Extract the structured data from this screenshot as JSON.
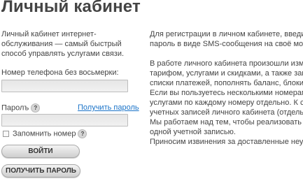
{
  "page": {
    "title": "Личный кабинет"
  },
  "intro": {
    "text": "Личный кабинет интернет-обслуживания — самый быстрый способ управлять услугами связи."
  },
  "form": {
    "phone_label": "Номер телефона без восьмерки:",
    "phone_value": "",
    "password_label": "Паролъ",
    "password_value": "",
    "password_help_icon": "question-icon",
    "get_password_link": "Получить пароль",
    "remember_label": "Запомнить номер",
    "remember_checked": false,
    "login_button": "ВОЙТИ",
    "get_password_button": "ПОЛУЧИТЬ ПАРОЛЬ",
    "help_glyph": "?"
  },
  "info": {
    "para1": [
      "Для регистрации в личном кабинете, введите номер",
      "пароль в виде SMS-сообщения на своё мобильное"
    ],
    "para2": [
      "В работе личного кабинета произошли изменения. В",
      "тарифом, услугами и скидками, а также заказывать",
      "списки платежей, пополнять баланс, блокировать S",
      "Если вы пользуетесь несколькими номерами, в тек",
      "услугами по каждому номеру отдельно. К сожален",
      "учетных записей личного кабинета (отдельно для к",
      "Мы работаем над тем, чтобы реализовать возможн",
      "одной учетной записью.",
      "Приносим извинения за доставленные неудобства."
    ]
  },
  "colors": {
    "link": "#1a73c8",
    "text": "#444444",
    "title": "#444444"
  }
}
